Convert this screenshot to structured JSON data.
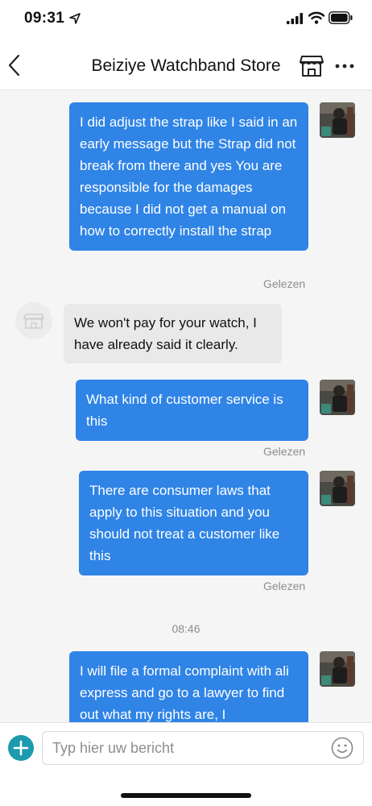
{
  "status_bar": {
    "time": "09:31",
    "icons": [
      "location-arrow-icon",
      "cellular-signal-icon",
      "wifi-icon",
      "battery-icon"
    ]
  },
  "header": {
    "title": "Beiziye Watchband Store",
    "icons": [
      "back-chevron-icon",
      "store-icon",
      "more-dots-icon"
    ]
  },
  "messages": [
    {
      "sender": "user",
      "text": "I did adjust the strap like I said in an early message but the Strap did not break from there and yes You are responsible for the damages because I did not get a manual on how to correctly install the strap",
      "status": "Gelezen"
    },
    {
      "sender": "store",
      "text": "We won't pay for your watch, I have already said it clearly."
    },
    {
      "sender": "user",
      "text": "What kind of customer service is this",
      "status": "Gelezen"
    },
    {
      "sender": "user",
      "text": "There are consumer laws that apply to this situation and you should not treat a customer like this",
      "status": "Gelezen"
    },
    {
      "sender": "user",
      "text": "I will file a formal complaint with ali express and go to a lawyer to find out what my rights are, I"
    }
  ],
  "timestamp": "08:46",
  "input": {
    "placeholder": "Typ hier uw bericht",
    "value": ""
  },
  "colors": {
    "outgoing_bubble": "#2f84e6",
    "incoming_bubble": "#e9e9e9",
    "add_button": "#1e9aae",
    "muted_text": "#8c8c8c"
  }
}
